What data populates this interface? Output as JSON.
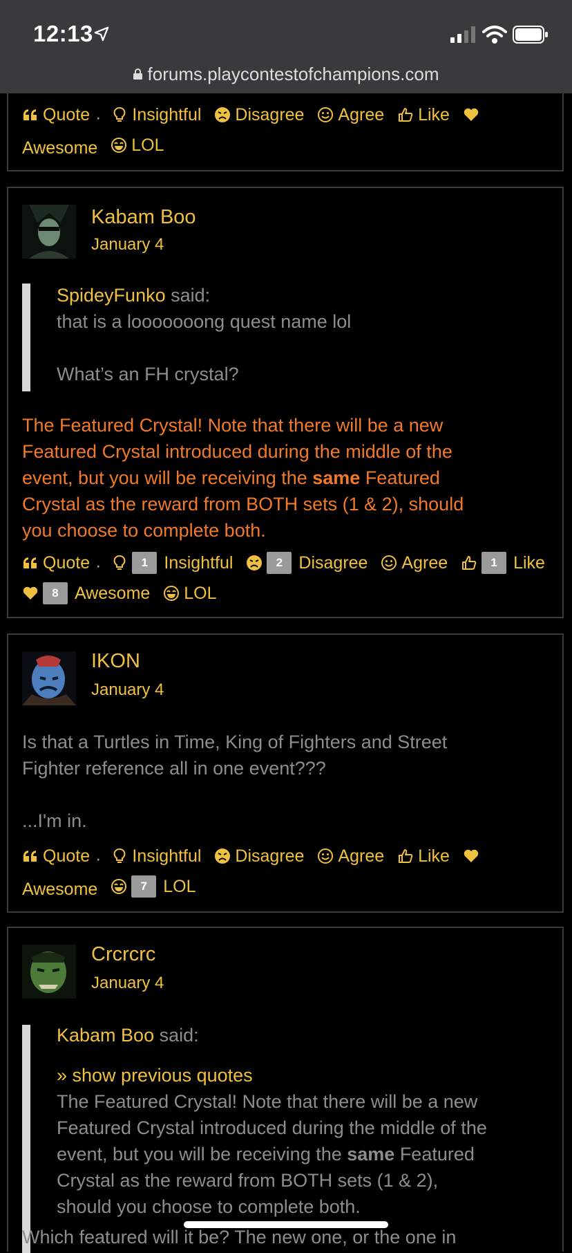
{
  "status": {
    "time": "12:13",
    "url": "forums.playcontestofchampions.com"
  },
  "reactions_labels": {
    "quote": "Quote",
    "insightful": "Insightful",
    "disagree": "Disagree",
    "agree": "Agree",
    "like": "Like",
    "awesome": "Awesome",
    "lol": "LOL"
  },
  "posts": [
    {
      "author": "Kabam Boo",
      "date": "January 4",
      "quote_author": "SpideyFunko",
      "said": "said:",
      "quote_lines": [
        "that is a looooooong quest name lol",
        "",
        "What’s an FH crystal?"
      ],
      "body_lines": [
        "The Featured Crystal! Note that there will be a new",
        "Featured Crystal introduced during the middle of the",
        "event, but you will be receiving the ",
        "same",
        " Featured",
        "Crystal as the reward from BOTH sets (1 & 2), should",
        "you choose to complete both."
      ],
      "counts": {
        "insightful": "1",
        "disagree": "2",
        "like": "1",
        "awesome": "8"
      }
    },
    {
      "author": "IKON",
      "date": "January 4",
      "body_lines": [
        "Is that a Turtles in Time, King of Fighters and Street",
        "Fighter reference all in one event???",
        "",
        "...I'm in."
      ],
      "counts": {
        "lol": "7"
      }
    },
    {
      "author": "Crcrcrc",
      "date": "January 4",
      "quote_author": "Kabam Boo",
      "said": "said:",
      "show_previous": "» show previous quotes",
      "quote_lines": [
        "The Featured Crystal! Note that there will be a new",
        "Featured Crystal introduced during the middle of the",
        "event, but you will be receiving the ",
        "same",
        " Featured",
        "Crystal as the reward from BOTH sets (1 & 2),",
        "should you choose to complete both."
      ],
      "body_partial": "Which featured will it be? The new one, or the one in"
    }
  ],
  "colors": {
    "accent": "#f0c040",
    "staff_text": "#f07a2a",
    "text": "#8d8d8d",
    "background": "#000000"
  }
}
